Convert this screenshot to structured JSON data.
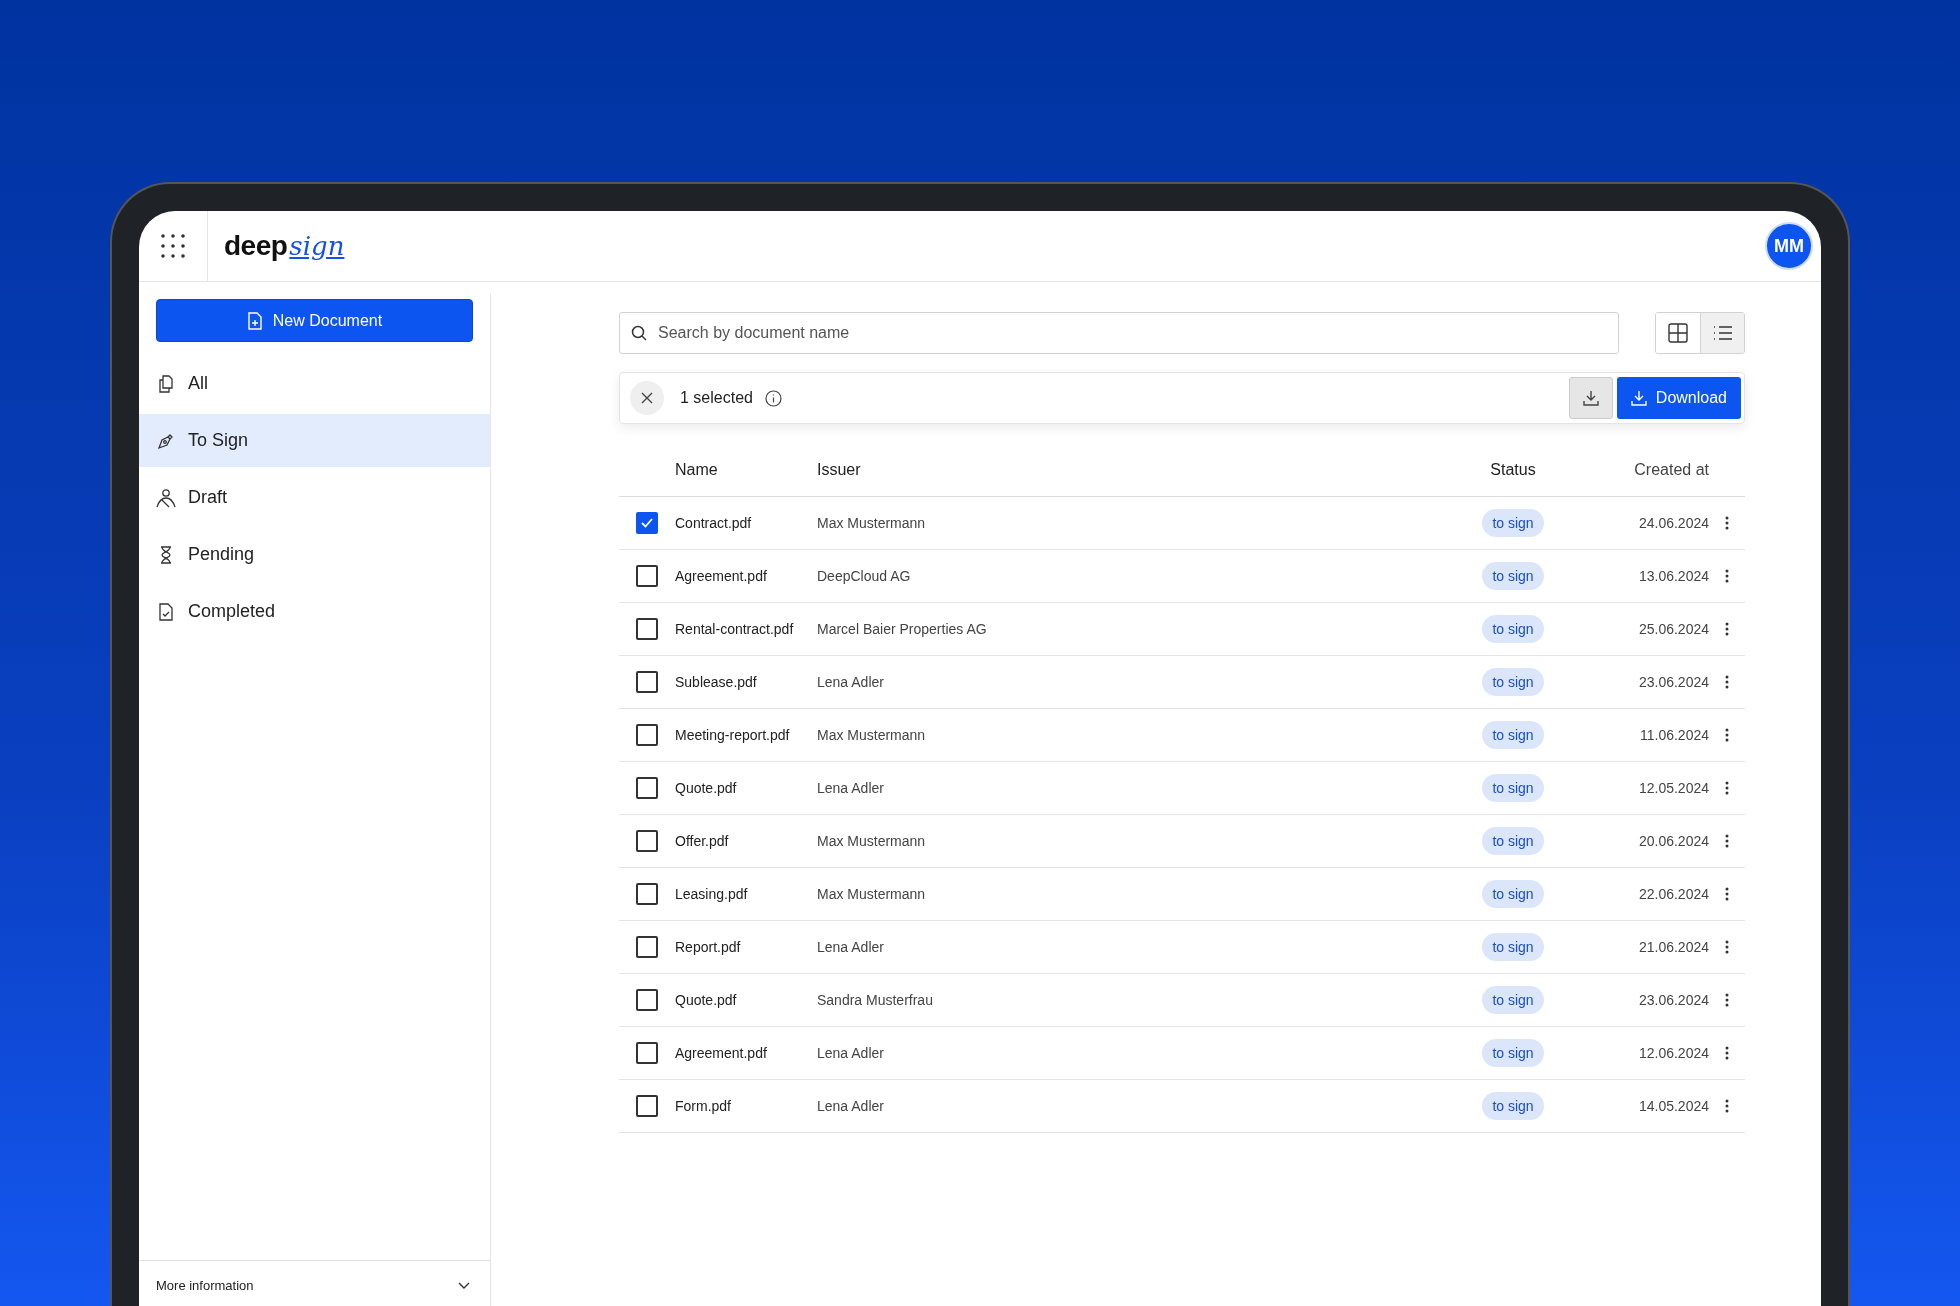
{
  "header": {
    "logo": {
      "text": "deep",
      "script": "sign"
    },
    "avatar": "MM"
  },
  "sidebar": {
    "new_button": "New Document",
    "items": [
      {
        "label": "All",
        "selected": false
      },
      {
        "label": "To Sign",
        "selected": true
      },
      {
        "label": "Draft",
        "selected": false
      },
      {
        "label": "Pending",
        "selected": false
      },
      {
        "label": "Completed",
        "selected": false
      }
    ],
    "footer": {
      "label": "More information",
      "expanded": false
    }
  },
  "search": {
    "placeholder": "Search by document name"
  },
  "view_toggle": [
    {
      "kind": "grid",
      "selected": false
    },
    {
      "kind": "list",
      "selected": true
    }
  ],
  "selection_bar": {
    "count": "1 selected",
    "download": "Download"
  },
  "table": {
    "columns": [
      "Name",
      "Issuer",
      "Status",
      "Created at"
    ],
    "rows": [
      {
        "checked": true,
        "name": "Contract.pdf",
        "issuer": "Max Mustermann",
        "status": "to sign",
        "created": "24.06.2024"
      },
      {
        "checked": false,
        "name": "Agreement.pdf",
        "issuer": "DeepCloud AG",
        "status": "to sign",
        "created": "13.06.2024"
      },
      {
        "checked": false,
        "name": "Rental-contract.pdf",
        "issuer": "Marcel Baier Properties AG",
        "status": "to sign",
        "created": "25.06.2024"
      },
      {
        "checked": false,
        "name": "Sublease.pdf",
        "issuer": "Lena Adler",
        "status": "to sign",
        "created": "23.06.2024"
      },
      {
        "checked": false,
        "name": "Meeting-report.pdf",
        "issuer": "Max Mustermann",
        "status": "to sign",
        "created": "11.06.2024"
      },
      {
        "checked": false,
        "name": "Quote.pdf",
        "issuer": "Lena Adler",
        "status": "to sign",
        "created": "12.05.2024"
      },
      {
        "checked": false,
        "name": "Offer.pdf",
        "issuer": "Max Mustermann",
        "status": "to sign",
        "created": "20.06.2024"
      },
      {
        "checked": false,
        "name": "Leasing.pdf",
        "issuer": "Max Mustermann",
        "status": "to sign",
        "created": "22.06.2024"
      },
      {
        "checked": false,
        "name": "Report.pdf",
        "issuer": "Lena Adler",
        "status": "to sign",
        "created": "21.06.2024"
      },
      {
        "checked": false,
        "name": "Quote.pdf",
        "issuer": "Sandra Musterfrau",
        "status": "to sign",
        "created": "23.06.2024"
      },
      {
        "checked": false,
        "name": "Agreement.pdf",
        "issuer": "Lena Adler",
        "status": "to sign",
        "created": "12.06.2024"
      },
      {
        "checked": false,
        "name": "Form.pdf",
        "issuer": "Lena Adler",
        "status": "to sign",
        "created": "14.05.2024"
      }
    ]
  }
}
